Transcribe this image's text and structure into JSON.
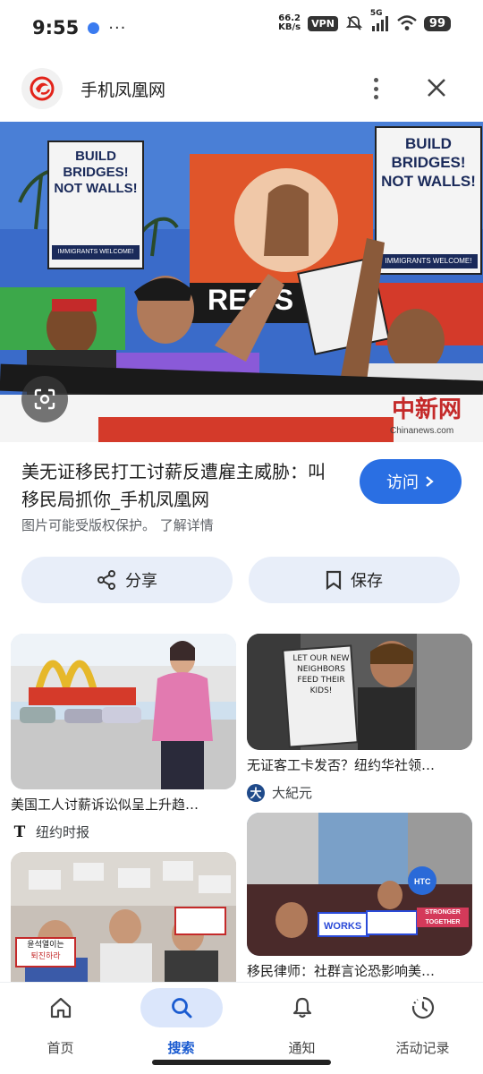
{
  "status_bar": {
    "time": "9:55",
    "more": "···",
    "net_speed_value": "66.2",
    "net_speed_unit": "KB/s",
    "vpn": "VPN",
    "network": "5G",
    "battery": "99"
  },
  "site": {
    "name": "手机凤凰网",
    "logo_icon": "phoenix-logo-icon",
    "accent": "#e2231a"
  },
  "hero": {
    "sign_left": "BUILD BRIDGES! NOT WALLS!",
    "sign_left_footer": "IMMIGRANTS WELCOME!",
    "sign_right": "BUILD BRIDGES! NOT WALLS!",
    "sign_right_footer": "IMMIGRANTS WELCOME!",
    "banner_text": "RESIS",
    "watermark_cn": "中新网",
    "watermark_en": "Chinanews.com"
  },
  "result": {
    "title": "美无证移民打工讨薪反遭雇主威胁：叫移民局抓你_手机凤凰网",
    "visit_label": "访问",
    "copyright_text": "图片可能受版权保护。",
    "learn_more": "了解详情"
  },
  "actions": {
    "share_label": "分享",
    "save_label": "保存"
  },
  "related": [
    {
      "caption": "美国工人讨薪诉讼似呈上升趋…",
      "source": "纽约时报",
      "source_icon": "nyt-icon"
    },
    {
      "caption": "无证客工卡发否？纽约华社领…",
      "source": "大紀元",
      "source_icon": "epoch-times-icon",
      "sign_text": "LET OUR NEW NEIGHBORS FEED THEIR KIDS!"
    },
    {
      "caption": "",
      "source": "",
      "sign_text_1": "윤석열이는",
      "sign_text_2": "퇴진하라"
    },
    {
      "caption": "移民律师：社群言论恐影响美…",
      "source": "",
      "sign_text": "WORKS",
      "sign_text_2": "STRONGER TOGETHER",
      "sign_text_3": "HTC"
    }
  ],
  "nav": {
    "items": [
      {
        "label": "首页",
        "icon": "home-icon"
      },
      {
        "label": "搜索",
        "icon": "search-icon",
        "active": true
      },
      {
        "label": "通知",
        "icon": "bell-icon"
      },
      {
        "label": "活动记录",
        "icon": "history-icon"
      }
    ],
    "accent": "#1a5bd0"
  }
}
